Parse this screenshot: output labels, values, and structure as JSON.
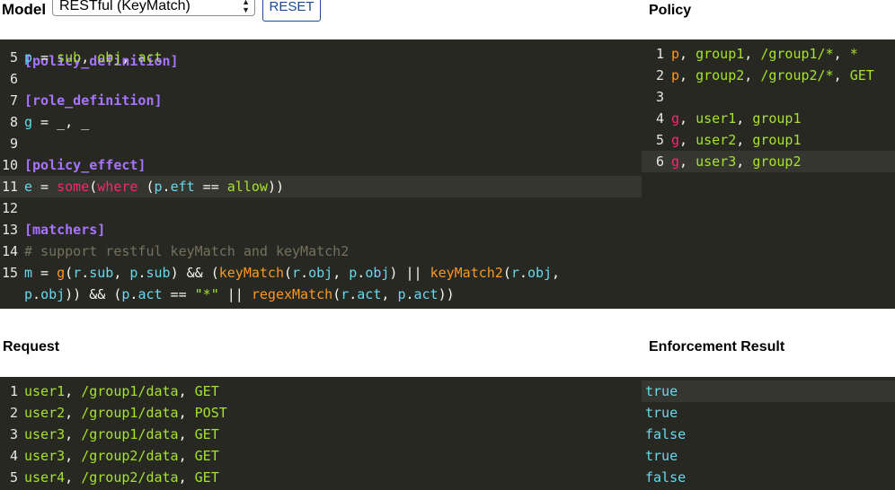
{
  "toolbar": {
    "model_label": "Model",
    "model_selected": "RESTful (KeyMatch)",
    "reset_label": "RESET",
    "policy_title": "Policy"
  },
  "model_editor": {
    "partial_line": "[policy_definition]",
    "lines": [
      {
        "n": "5",
        "tokens": [
          {
            "c": "v",
            "t": "p"
          },
          {
            "c": "pl",
            "t": " = "
          },
          {
            "c": "s",
            "t": "sub"
          },
          {
            "c": "pl",
            "t": ", "
          },
          {
            "c": "s",
            "t": "obj"
          },
          {
            "c": "pl",
            "t": ", "
          },
          {
            "c": "s",
            "t": "act"
          }
        ]
      },
      {
        "n": "6",
        "tokens": []
      },
      {
        "n": "7",
        "tokens": [
          {
            "c": "kw",
            "t": "[role_definition]"
          }
        ]
      },
      {
        "n": "8",
        "tokens": [
          {
            "c": "v",
            "t": "g"
          },
          {
            "c": "pl",
            "t": " = _, _"
          }
        ]
      },
      {
        "n": "9",
        "tokens": []
      },
      {
        "n": "10",
        "tokens": [
          {
            "c": "kw",
            "t": "[policy_effect]"
          }
        ]
      },
      {
        "n": "11",
        "tokens": [
          {
            "c": "v",
            "t": "e"
          },
          {
            "c": "pl",
            "t": " = "
          },
          {
            "c": "g",
            "t": "some"
          },
          {
            "c": "pl",
            "t": "("
          },
          {
            "c": "g",
            "t": "where"
          },
          {
            "c": "pl",
            "t": " ("
          },
          {
            "c": "v",
            "t": "p"
          },
          {
            "c": "pl",
            "t": "."
          },
          {
            "c": "v",
            "t": "eft"
          },
          {
            "c": "pl",
            "t": " == "
          },
          {
            "c": "s",
            "t": "allow"
          },
          {
            "c": "pl",
            "t": "))"
          }
        ]
      },
      {
        "n": "12",
        "tokens": []
      },
      {
        "n": "13",
        "tokens": [
          {
            "c": "kw",
            "t": "[matchers]"
          }
        ]
      },
      {
        "n": "14",
        "tokens": [
          {
            "c": "c",
            "t": "# support restful keyMatch and keyMatch2"
          }
        ]
      },
      {
        "n": "15",
        "tokens": [
          {
            "c": "v",
            "t": "m"
          },
          {
            "c": "pl",
            "t": " = "
          },
          {
            "c": "f",
            "t": "g"
          },
          {
            "c": "pl",
            "t": "("
          },
          {
            "c": "v",
            "t": "r"
          },
          {
            "c": "pl",
            "t": "."
          },
          {
            "c": "v",
            "t": "sub"
          },
          {
            "c": "pl",
            "t": ", "
          },
          {
            "c": "v",
            "t": "p"
          },
          {
            "c": "pl",
            "t": "."
          },
          {
            "c": "v",
            "t": "sub"
          },
          {
            "c": "pl",
            "t": ") && ("
          },
          {
            "c": "f",
            "t": "keyMatch"
          },
          {
            "c": "pl",
            "t": "("
          },
          {
            "c": "v",
            "t": "r"
          },
          {
            "c": "pl",
            "t": "."
          },
          {
            "c": "v",
            "t": "obj"
          },
          {
            "c": "pl",
            "t": ", "
          },
          {
            "c": "v",
            "t": "p"
          },
          {
            "c": "pl",
            "t": "."
          },
          {
            "c": "v",
            "t": "obj"
          },
          {
            "c": "pl",
            "t": ") || "
          },
          {
            "c": "f",
            "t": "keyMatch2"
          },
          {
            "c": "pl",
            "t": "("
          },
          {
            "c": "v",
            "t": "r"
          },
          {
            "c": "pl",
            "t": "."
          },
          {
            "c": "v",
            "t": "obj"
          },
          {
            "c": "pl",
            "t": ","
          }
        ]
      },
      {
        "n": "",
        "tokens": [
          {
            "c": "v",
            "t": "p"
          },
          {
            "c": "pl",
            "t": "."
          },
          {
            "c": "v",
            "t": "obj"
          },
          {
            "c": "pl",
            "t": ")) && ("
          },
          {
            "c": "v",
            "t": "p"
          },
          {
            "c": "pl",
            "t": "."
          },
          {
            "c": "v",
            "t": "act"
          },
          {
            "c": "pl",
            "t": " == "
          },
          {
            "c": "s",
            "t": "\"*\""
          },
          {
            "c": "pl",
            "t": " || "
          },
          {
            "c": "f",
            "t": "regexMatch"
          },
          {
            "c": "pl",
            "t": "("
          },
          {
            "c": "v",
            "t": "r"
          },
          {
            "c": "pl",
            "t": "."
          },
          {
            "c": "v",
            "t": "act"
          },
          {
            "c": "pl",
            "t": ", "
          },
          {
            "c": "v",
            "t": "p"
          },
          {
            "c": "pl",
            "t": "."
          },
          {
            "c": "v",
            "t": "act"
          },
          {
            "c": "pl",
            "t": "))"
          }
        ]
      }
    ]
  },
  "policy_editor": {
    "lines": [
      {
        "n": "1",
        "tokens": [
          {
            "c": "p",
            "t": "p"
          },
          {
            "c": "pl",
            "t": ", "
          },
          {
            "c": "s",
            "t": "group1"
          },
          {
            "c": "pl",
            "t": ", "
          },
          {
            "c": "s",
            "t": "/group1/*"
          },
          {
            "c": "pl",
            "t": ", "
          },
          {
            "c": "s",
            "t": "*"
          }
        ]
      },
      {
        "n": "2",
        "tokens": [
          {
            "c": "p",
            "t": "p"
          },
          {
            "c": "pl",
            "t": ", "
          },
          {
            "c": "s",
            "t": "group2"
          },
          {
            "c": "pl",
            "t": ", "
          },
          {
            "c": "s",
            "t": "/group2/*"
          },
          {
            "c": "pl",
            "t": ", "
          },
          {
            "c": "s",
            "t": "GET"
          }
        ]
      },
      {
        "n": "3",
        "tokens": []
      },
      {
        "n": "4",
        "tokens": [
          {
            "c": "g",
            "t": "g"
          },
          {
            "c": "pl",
            "t": ", "
          },
          {
            "c": "s",
            "t": "user1"
          },
          {
            "c": "pl",
            "t": ", "
          },
          {
            "c": "s",
            "t": "group1"
          }
        ]
      },
      {
        "n": "5",
        "tokens": [
          {
            "c": "g",
            "t": "g"
          },
          {
            "c": "pl",
            "t": ", "
          },
          {
            "c": "s",
            "t": "user2"
          },
          {
            "c": "pl",
            "t": ", "
          },
          {
            "c": "s",
            "t": "group1"
          }
        ]
      },
      {
        "n": "6",
        "tokens": [
          {
            "c": "g",
            "t": "g"
          },
          {
            "c": "pl",
            "t": ", "
          },
          {
            "c": "s",
            "t": "user3"
          },
          {
            "c": "pl",
            "t": ", "
          },
          {
            "c": "s",
            "t": "group2"
          }
        ]
      }
    ]
  },
  "request": {
    "title": "Request",
    "lines": [
      {
        "n": "1",
        "tokens": [
          {
            "c": "s",
            "t": "user1"
          },
          {
            "c": "pl",
            "t": ", "
          },
          {
            "c": "s",
            "t": "/group1/data"
          },
          {
            "c": "pl",
            "t": ", "
          },
          {
            "c": "s",
            "t": "GET"
          }
        ]
      },
      {
        "n": "2",
        "tokens": [
          {
            "c": "s",
            "t": "user2"
          },
          {
            "c": "pl",
            "t": ", "
          },
          {
            "c": "s",
            "t": "/group1/data"
          },
          {
            "c": "pl",
            "t": ", "
          },
          {
            "c": "s",
            "t": "POST"
          }
        ]
      },
      {
        "n": "3",
        "tokens": [
          {
            "c": "s",
            "t": "user3"
          },
          {
            "c": "pl",
            "t": ", "
          },
          {
            "c": "s",
            "t": "/group1/data"
          },
          {
            "c": "pl",
            "t": ", "
          },
          {
            "c": "s",
            "t": "GET"
          }
        ]
      },
      {
        "n": "4",
        "tokens": [
          {
            "c": "s",
            "t": "user3"
          },
          {
            "c": "pl",
            "t": ", "
          },
          {
            "c": "s",
            "t": "/group2/data"
          },
          {
            "c": "pl",
            "t": ", "
          },
          {
            "c": "s",
            "t": "GET"
          }
        ]
      },
      {
        "n": "5",
        "tokens": [
          {
            "c": "s",
            "t": "user4"
          },
          {
            "c": "pl",
            "t": ", "
          },
          {
            "c": "s",
            "t": "/group2/data"
          },
          {
            "c": "pl",
            "t": ", "
          },
          {
            "c": "s",
            "t": "GET"
          }
        ]
      }
    ]
  },
  "enforcement": {
    "title": "Enforcement Result",
    "results": [
      "true",
      "true",
      "false",
      "true",
      "false"
    ]
  },
  "colors": {
    "editor_bg": "#272822",
    "active_line": "#35362f",
    "keyword": "#a774ff",
    "variable": "#66d9ef",
    "string": "#a6e22e",
    "function": "#fd971f",
    "accent_pink": "#f92672",
    "comment": "#75715e"
  }
}
